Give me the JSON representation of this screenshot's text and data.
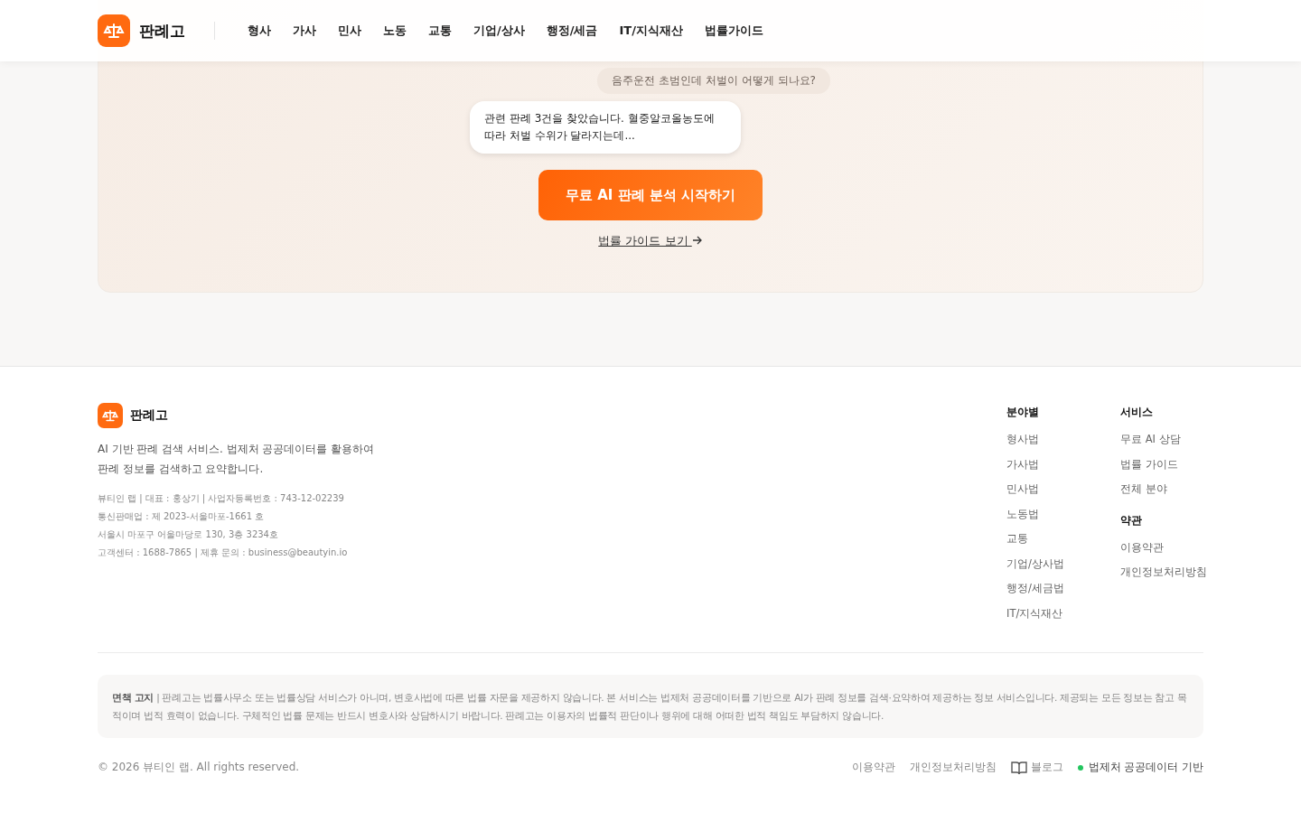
{
  "header": {
    "brand": "판례고",
    "nav": [
      {
        "label": "형사"
      },
      {
        "label": "가사"
      },
      {
        "label": "민사"
      },
      {
        "label": "노동"
      },
      {
        "label": "교통"
      },
      {
        "label": "기업/상사"
      },
      {
        "label": "행정/세금"
      },
      {
        "label": "IT/지식재산"
      },
      {
        "label": "법률가이드"
      }
    ]
  },
  "hero": {
    "user_message": "음주운전 초범인데 처벌이 어떻게 되나요?",
    "ai_message": "관련 판례 3건을 찾았습니다. 혈중알코올농도에 따라 처벌 수위가 달라지는데...",
    "cta_button": "무료 AI 판례 분석 시작하기",
    "guide_link": "법률 가이드 보기"
  },
  "footer": {
    "brand": "판례고",
    "description": "AI 기반 판례 검색 서비스. 법제처 공공데이터를 활용하여 판례 정보를 검색하고 요약합니다.",
    "company_info": [
      "뷰티인 랩 | 대표 : 홍상기 | 사업자등록번호 : 743-12-02239",
      "통신판매업 : 제 2023-서울마포-1661 호",
      "서울시 마포구 어울마당로 130, 3층 3234호",
      "고객센터 : 1688-7865 | 제휴 문의 : business@beautyin.io"
    ],
    "columns": [
      {
        "title": "분야별",
        "links": [
          "형사법",
          "가사법",
          "민사법",
          "노동법",
          "교통",
          "기업/상사법",
          "행정/세금법",
          "IT/지식재산"
        ]
      },
      {
        "groups": [
          {
            "title": "서비스",
            "links": [
              "무료 AI 상담",
              "법률 가이드",
              "전체 분야"
            ]
          },
          {
            "title": "약관",
            "links": [
              "이용약관",
              "개인정보처리방침"
            ]
          }
        ]
      }
    ],
    "disclaimer": "**면책 고지** | 판례고는 법률사무소 또는 법률상담 서비스가 아니며, 변호사법에 따른 법률 자문을 제공하지 않습니다. 본 서비스는 법제처 공공데이터를 기반으로 AI가 판례 정보를 검색·요약하여 제공하는 정보 서비스입니다. 제공되는 모든 정보는 참고 목적이며 법적 효력이 없습니다. 구체적인 법률 문제는 반드시 변호사와 상담하시기 바랍니다. 판례고는 이용자의 법률적 판단이나 행위에 대해 어떠한 법적 책임도 부담하지 않습니다.",
    "copyright": "© 2026 뷰티인 랩. All rights reserved.",
    "bottom_links": [
      {
        "kind": "text",
        "label": "이용약관"
      },
      {
        "kind": "text",
        "label": "개인정보처리방침"
      },
      {
        "kind": "book",
        "label": "블로그"
      },
      {
        "kind": "status",
        "label": "법제처 공공데이터 기반",
        "color": "#22c55e"
      }
    ]
  }
}
